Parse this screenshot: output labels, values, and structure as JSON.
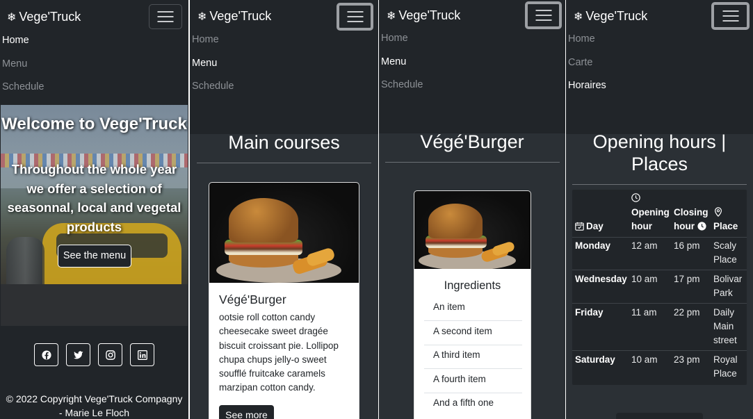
{
  "brand": "Vege'Truck",
  "panel1": {
    "nav": [
      "Home",
      "Menu",
      "Schedule"
    ],
    "active": 0,
    "hero_title": "Welcome to Vege'Truck",
    "hero_subtitle": "Throughout the whole year we offer a selection of seasonnal, local and vegetal products",
    "hero_button": "See the menu",
    "socials": [
      "facebook-icon",
      "twitter-icon",
      "instagram-icon",
      "linkedin-icon"
    ],
    "footer": "© 2022 Copyright Vege'Truck Compagny - Marie Le Floch"
  },
  "panel2": {
    "nav": [
      "Home",
      "Menu",
      "Schedule"
    ],
    "active": 1,
    "title": "Main courses",
    "card_title": "Végé'Burger",
    "card_text": "ootsie roll cotton candy cheesecake sweet dragée biscuit croissant pie. Lollipop chupa chups jelly-o sweet soufflé fruitcake caramels marzipan cotton candy.",
    "card_button": "See more"
  },
  "panel3": {
    "nav": [
      "Home",
      "Menu",
      "Schedule"
    ],
    "active": 1,
    "title": "Végé'Burger",
    "ingredients_title": "Ingredients",
    "ingredients": [
      "An item",
      "A second item",
      "A third item",
      "A fourth item",
      "And a fifth one"
    ]
  },
  "panel4": {
    "nav": [
      "Home",
      "Carte",
      "Horaires"
    ],
    "active": 2,
    "title_line1": "Opening hours |",
    "title_line2": "Places",
    "headers": {
      "day": "Day",
      "opening_1": "Opening",
      "opening_2": "hour",
      "closing_1": "Closing",
      "closing_2": "hour",
      "place": "Place"
    },
    "rows": [
      {
        "day": "Monday",
        "open": "12 am",
        "close": "16 pm",
        "place1": "Scaly",
        "place2": "Place",
        "place3": ""
      },
      {
        "day": "Wednesday",
        "open": "10 am",
        "close": "17 pm",
        "place1": "Bolivar",
        "place2": "Park",
        "place3": ""
      },
      {
        "day": "Friday",
        "open": "11 am",
        "close": "22 pm",
        "place1": "Daily",
        "place2": "Main",
        "place3": "street"
      },
      {
        "day": "Saturday",
        "open": "10 am",
        "close": "23 pm",
        "place1": "Royal",
        "place2": "Place",
        "place3": ""
      }
    ]
  }
}
